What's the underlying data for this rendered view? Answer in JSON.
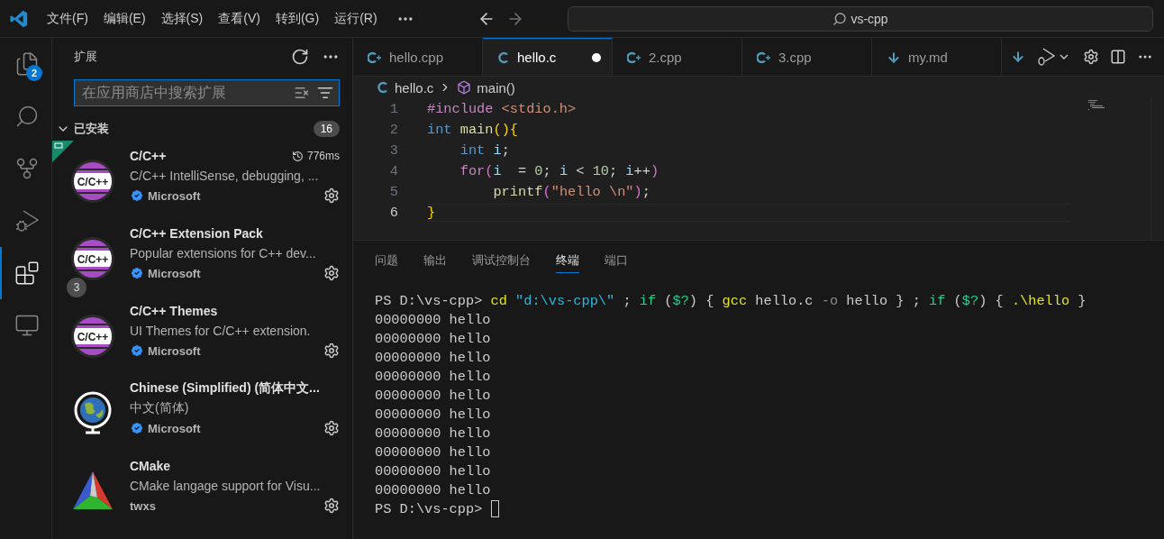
{
  "menu": [
    "文件(F)",
    "编辑(E)",
    "选择(S)",
    "查看(V)",
    "转到(G)",
    "运行(R)"
  ],
  "command_center": {
    "text": "vs-cpp"
  },
  "activity_bar": [
    {
      "kind": "files",
      "selected": false,
      "badge": "2"
    },
    {
      "kind": "search",
      "selected": false
    },
    {
      "kind": "source-control",
      "selected": false
    },
    {
      "kind": "run-debug",
      "selected": false
    },
    {
      "kind": "extensions",
      "selected": true
    },
    {
      "kind": "remote",
      "selected": false
    }
  ],
  "sidebar": {
    "title": "扩展",
    "search": {
      "placeholder": "在应用商店中搜索扩展"
    },
    "section": {
      "title": "已安装",
      "expanded": true,
      "count": "16"
    },
    "extensions": [
      {
        "kind": "cpp",
        "logo_text": "C/C++",
        "name": "C/C++",
        "description": "C/C++ IntelliSense, debugging, ...",
        "publisher": "Microsoft",
        "verified": true,
        "time": "776ms",
        "prerelease": true
      },
      {
        "kind": "cpp",
        "logo_text": "C/C++",
        "name": "C/C++ Extension Pack",
        "description": "Popular extensions for C++ dev...",
        "publisher": "Microsoft",
        "verified": true,
        "badge": "3",
        "prerelease": false
      },
      {
        "kind": "cpp",
        "logo_text": "C/C++",
        "name": "C/C++ Themes",
        "description": "UI Themes for C/C++ extension.",
        "publisher": "Microsoft",
        "verified": true,
        "prerelease": false
      },
      {
        "kind": "globe",
        "name": "Chinese (Simplified) (简体中文...",
        "description": "中文(简体)",
        "publisher": "Microsoft",
        "verified": true,
        "prerelease": false
      },
      {
        "kind": "cmake",
        "name": "CMake",
        "description": "CMake langage support for Visu...",
        "publisher": "twxs",
        "verified": false,
        "prerelease": false
      }
    ]
  },
  "tabs": [
    {
      "kind": "cpp",
      "label": "hello.cpp",
      "selected": false,
      "modified": false
    },
    {
      "kind": "c",
      "label": "hello.c",
      "selected": true,
      "modified": true
    },
    {
      "kind": "cpp",
      "label": "2.cpp",
      "selected": false,
      "modified": false
    },
    {
      "kind": "cpp",
      "label": "3.cpp",
      "selected": false,
      "modified": false
    },
    {
      "kind": "md",
      "label": "my.md",
      "selected": false,
      "modified": false
    }
  ],
  "breadcrumb": {
    "file": "hello.c",
    "symbol": "main()"
  },
  "code": [
    {
      "number": "1",
      "current": false,
      "tokens": [
        {
          "kind": "preproc",
          "text": "#include"
        },
        {
          "kind": "string",
          "text": " <stdio.h>"
        }
      ]
    },
    {
      "number": "2",
      "current": false,
      "tokens": [
        {
          "kind": "keyword",
          "text": "int"
        },
        {
          "kind": "function",
          "text": " main"
        },
        {
          "kind": "bracket1",
          "text": "(){"
        }
      ]
    },
    {
      "number": "3",
      "current": false,
      "tokens": [
        {
          "kind": "keyword",
          "text": "    int"
        },
        {
          "kind": "variable",
          "text": " i"
        },
        {
          "kind": "plain",
          "text": ";"
        }
      ]
    },
    {
      "number": "4",
      "current": false,
      "tokens": [
        {
          "kind": "control",
          "text": "    for"
        },
        {
          "kind": "bracket2",
          "text": "("
        },
        {
          "kind": "variable",
          "text": "i"
        },
        {
          "kind": "plain",
          "text": "  = "
        },
        {
          "kind": "number",
          "text": "0"
        },
        {
          "kind": "plain",
          "text": "; "
        },
        {
          "kind": "variable",
          "text": "i"
        },
        {
          "kind": "plain",
          "text": " < "
        },
        {
          "kind": "number",
          "text": "10"
        },
        {
          "kind": "plain",
          "text": "; "
        },
        {
          "kind": "variable",
          "text": "i"
        },
        {
          "kind": "plain",
          "text": "++"
        },
        {
          "kind": "bracket2",
          "text": ")"
        }
      ]
    },
    {
      "number": "5",
      "current": false,
      "tokens": [
        {
          "kind": "function",
          "text": "        printf"
        },
        {
          "kind": "bracket2",
          "text": "("
        },
        {
          "kind": "string",
          "text": "\"hello \\n\""
        },
        {
          "kind": "bracket2",
          "text": ")"
        },
        {
          "kind": "plain",
          "text": ";"
        }
      ]
    },
    {
      "number": "6",
      "current": true,
      "tokens": [
        {
          "kind": "bracket1",
          "text": "}"
        }
      ]
    }
  ],
  "panel_tabs": [
    {
      "label": "问题",
      "selected": false
    },
    {
      "label": "输出",
      "selected": false
    },
    {
      "label": "调试控制台",
      "selected": false
    },
    {
      "label": "终端",
      "selected": true
    },
    {
      "label": "端口",
      "selected": false
    }
  ],
  "terminal": [
    {
      "cursor": false,
      "tokens": [
        {
          "kind": "plain",
          "text": "PS D:\\vs-cpp> "
        },
        {
          "kind": "command",
          "text": "cd"
        },
        {
          "kind": "string",
          "text": " \"d:\\vs-cpp\\\""
        },
        {
          "kind": "plain",
          "text": " ; "
        },
        {
          "kind": "keyword",
          "text": "if"
        },
        {
          "kind": "plain",
          "text": " ("
        },
        {
          "kind": "keyword",
          "text": "$?"
        },
        {
          "kind": "plain",
          "text": ") { "
        },
        {
          "kind": "command",
          "text": "gcc"
        },
        {
          "kind": "plain",
          "text": " hello.c "
        },
        {
          "kind": "flag",
          "text": "-o"
        },
        {
          "kind": "plain",
          "text": " hello } ; "
        },
        {
          "kind": "keyword",
          "text": "if"
        },
        {
          "kind": "plain",
          "text": " ("
        },
        {
          "kind": "keyword",
          "text": "$?"
        },
        {
          "kind": "plain",
          "text": ") { "
        },
        {
          "kind": "command",
          "text": ".\\hello"
        },
        {
          "kind": "plain",
          "text": " }"
        }
      ]
    },
    {
      "cursor": false,
      "tokens": [
        {
          "kind": "plain",
          "text": "00000000 hello"
        }
      ]
    },
    {
      "cursor": false,
      "tokens": [
        {
          "kind": "plain",
          "text": "00000000 hello"
        }
      ]
    },
    {
      "cursor": false,
      "tokens": [
        {
          "kind": "plain",
          "text": "00000000 hello"
        }
      ]
    },
    {
      "cursor": false,
      "tokens": [
        {
          "kind": "plain",
          "text": "00000000 hello"
        }
      ]
    },
    {
      "cursor": false,
      "tokens": [
        {
          "kind": "plain",
          "text": "00000000 hello"
        }
      ]
    },
    {
      "cursor": false,
      "tokens": [
        {
          "kind": "plain",
          "text": "00000000 hello"
        }
      ]
    },
    {
      "cursor": false,
      "tokens": [
        {
          "kind": "plain",
          "text": "00000000 hello"
        }
      ]
    },
    {
      "cursor": false,
      "tokens": [
        {
          "kind": "plain",
          "text": "00000000 hello"
        }
      ]
    },
    {
      "cursor": false,
      "tokens": [
        {
          "kind": "plain",
          "text": "00000000 hello"
        }
      ]
    },
    {
      "cursor": false,
      "tokens": [
        {
          "kind": "plain",
          "text": "00000000 hello"
        }
      ]
    },
    {
      "cursor": true,
      "tokens": [
        {
          "kind": "plain",
          "text": "PS D:\\vs-cpp> "
        }
      ]
    }
  ]
}
